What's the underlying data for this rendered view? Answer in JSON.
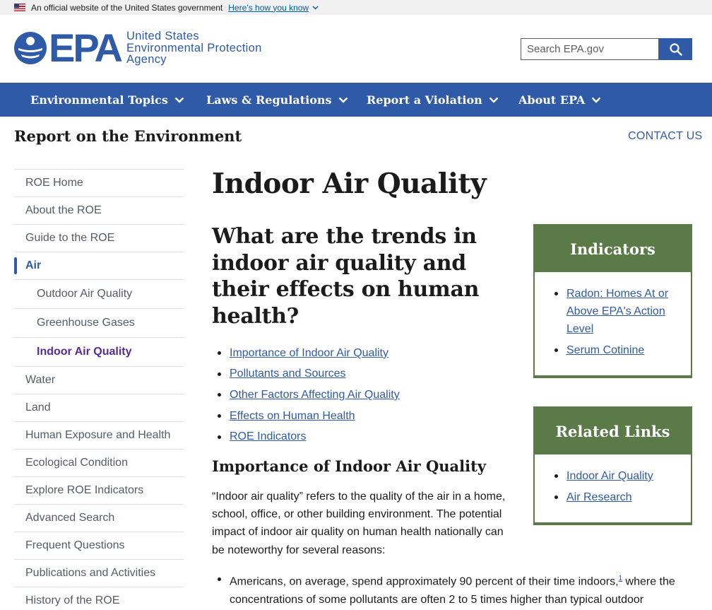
{
  "gov_banner": {
    "text": "An official website of the United States government",
    "link": "Here’s how you know"
  },
  "header": {
    "logo_letters": "EPA",
    "agency_lines": [
      "United States",
      "Environmental Protection",
      "Agency"
    ],
    "search_placeholder": "Search EPA.gov"
  },
  "nav": {
    "items": [
      {
        "label": "Environmental Topics"
      },
      {
        "label": "Laws & Regulations"
      },
      {
        "label": "Report a Violation"
      },
      {
        "label": "About EPA"
      }
    ]
  },
  "site": {
    "title": "Report on the Environment",
    "contact": "CONTACT US"
  },
  "sidenav": {
    "items": [
      {
        "label": "ROE Home"
      },
      {
        "label": "About the ROE"
      },
      {
        "label": "Guide to the ROE"
      },
      {
        "label": "Air"
      },
      {
        "label": "Outdoor Air Quality"
      },
      {
        "label": "Greenhouse Gases"
      },
      {
        "label": "Indoor Air Quality"
      },
      {
        "label": "Water"
      },
      {
        "label": "Land"
      },
      {
        "label": "Human Exposure and Health"
      },
      {
        "label": "Ecological Condition"
      },
      {
        "label": "Explore ROE Indicators"
      },
      {
        "label": "Advanced Search"
      },
      {
        "label": "Frequent Questions"
      },
      {
        "label": "Publications and Activities"
      },
      {
        "label": "History of the ROE"
      }
    ]
  },
  "main": {
    "title": "Indoor Air Quality",
    "question": "What are the trends in indoor air quality and their effects on human health?",
    "toc": [
      {
        "label": "Importance of Indoor Air Quality"
      },
      {
        "label": "Pollutants and Sources"
      },
      {
        "label": "Other Factors Affecting Air Quality"
      },
      {
        "label": "Effects on Human Health"
      },
      {
        "label": "ROE Indicators"
      }
    ],
    "section_heading": "Importance of Indoor Air Quality",
    "paragraph": "“Indoor air quality” refers to the quality of the air in a home, school, office, or other building environment. The potential impact of indoor air quality on human health nationally can be noteworthy for several reasons:",
    "bullet_1a": "Americans, on average, spend approximately 90 percent of their time indoors,",
    "bullet_1_footnote": "1",
    "bullet_1b": " where the concentrations of some pollutants are often 2 to 5 times higher than typical outdoor"
  },
  "indicators_box": {
    "title": "Indicators",
    "links": [
      {
        "label": "Radon: Homes At or Above EPA's Action Level"
      },
      {
        "label": "Serum Cotinine"
      }
    ]
  },
  "related_box": {
    "title": "Related Links",
    "links": [
      {
        "label": "Indoor Air Quality"
      },
      {
        "label": "Air Research"
      }
    ]
  }
}
